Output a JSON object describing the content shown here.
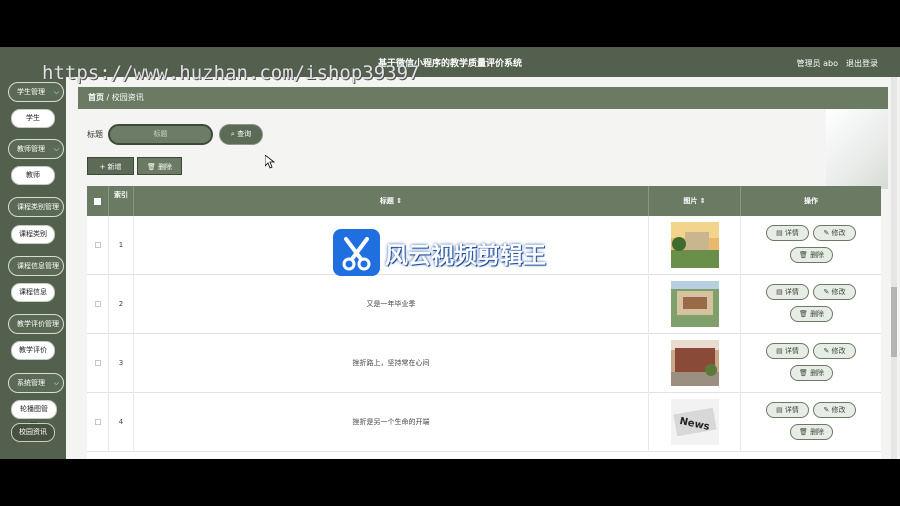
{
  "header": {
    "title": "基于微信小程序的教学质量评价系统",
    "user": "管理员 abo",
    "logout": "退出登录"
  },
  "sidebar": {
    "groups": [
      {
        "label": "学生管理",
        "items": [
          "学生"
        ]
      },
      {
        "label": "教师管理",
        "items": [
          "教师"
        ]
      },
      {
        "label": "课程类别管理",
        "items": [
          "课程类别"
        ]
      },
      {
        "label": "课程信息管理",
        "items": [
          "课程信息"
        ]
      },
      {
        "label": "教学评价管理",
        "items": [
          "教学评价"
        ]
      },
      {
        "label": "系统管理",
        "items": [
          "轮播图管理",
          "校园资讯"
        ]
      }
    ]
  },
  "breadcrumb": {
    "home": "首页",
    "separator": "/",
    "current": "校园资讯"
  },
  "search": {
    "label": "标题",
    "placeholder": "标题",
    "button": "查询"
  },
  "actions": {
    "add": "新增",
    "delete": "删除"
  },
  "table": {
    "headers": {
      "index": "索引",
      "title": "标题",
      "image": "图片",
      "ops": "操作"
    },
    "rows": [
      {
        "index": "1",
        "title": ""
      },
      {
        "index": "2",
        "title": "又是一年毕业季"
      },
      {
        "index": "3",
        "title": "挫折路上，坚持常在心间"
      },
      {
        "index": "4",
        "title": "挫折是另一个生命的开端"
      }
    ],
    "op_labels": {
      "detail": "详情",
      "edit": "修改",
      "delete": "删除"
    }
  },
  "overlays": {
    "url_watermark": "https://www.huzhan.com/ishop39397",
    "app_watermark": "风云视频剪辑王"
  },
  "icons": {
    "search": "magnifier-icon",
    "add": "plus-icon",
    "delete": "trash-icon",
    "detail": "doc-icon",
    "edit": "pencil-icon",
    "checkbox": "checkbox-icon"
  },
  "colors": {
    "primary": "#53604e",
    "header": "#6a7a63",
    "accent": "#1f6fe0"
  }
}
